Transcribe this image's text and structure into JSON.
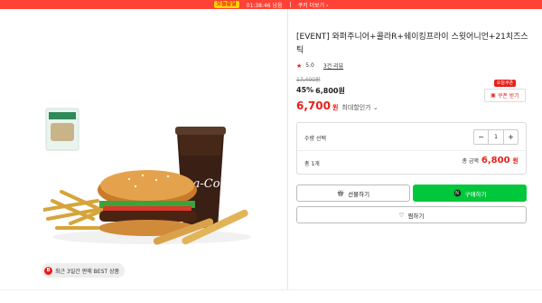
{
  "topbar": {
    "badge": "오늘끝딜",
    "timer": "01:38:46 남음",
    "more": "쿠키 더보기 ›"
  },
  "product": {
    "title": "[EVENT] 와퍼주니어+콜라R+쉐이킹프라이 스윗어니언+21치즈스틱",
    "rating": "5.0",
    "reviews": "3건 리뷰",
    "original_price": "17,400원",
    "discount_pct": "45%",
    "discount_price": "6,800원",
    "final_price": "6,700",
    "final_won": "원",
    "max_discount": "최대할인가",
    "best_tag": "최근 3일간 판매 BEST 상품",
    "best_dot": "B"
  },
  "coupon": {
    "mini_badge": "오늘쿠폰",
    "button": "쿠폰 받기"
  },
  "quantity": {
    "label": "수량 선택",
    "value": "1",
    "minus": "−",
    "plus": "+",
    "count": "총 1개",
    "total_label": "총 금액",
    "total_amount": "6,800",
    "total_won": "원"
  },
  "actions": {
    "gift": "선물하기",
    "buy": "구매하기",
    "wish": "찜하기",
    "buy_badge": "N"
  },
  "colors": {
    "accent": "#e8201a",
    "buy_green": "#00c73c",
    "topbar": "#ff4136"
  }
}
